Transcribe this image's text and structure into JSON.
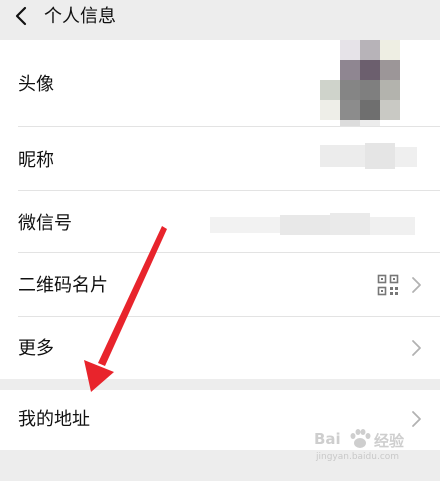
{
  "header": {
    "title": "个人信息",
    "back_icon": "chevron-left-icon"
  },
  "profile": {
    "items": [
      {
        "label": "头像",
        "value_hidden": true
      },
      {
        "label": "昵称",
        "value_hidden": true
      },
      {
        "label": "微信号",
        "value_hidden": true
      },
      {
        "label": "二维码名片",
        "icon": "qr-code-icon"
      },
      {
        "label": "更多"
      }
    ]
  },
  "address": {
    "label": "我的地址"
  },
  "watermark": {
    "brand": "Bai",
    "suffix": "经验",
    "url": "jingyan.baidu.com"
  },
  "colors": {
    "background": "#ededed",
    "card": "#ffffff",
    "arrow": "#e8242c",
    "chevron": "#b2b2b2"
  }
}
